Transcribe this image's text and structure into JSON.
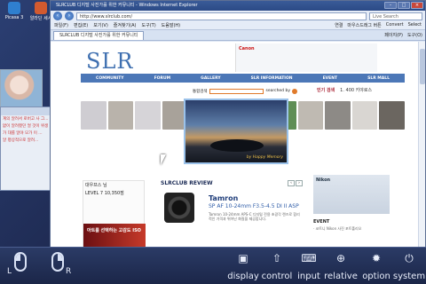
{
  "desktop": {
    "icons": [
      {
        "label": "Picasa 3",
        "color": "#2f7fcf"
      },
      {
        "label": "알라딘 세시",
        "color": "#d35a2f"
      }
    ],
    "left_window_lines": [
      "계의 알려서 로버고 사 그...",
      "없이 알려줬던 얼 것이 위생 ...",
      "가 대를 알야 모가 이 ...",
      "알 평상적으로 알려..."
    ]
  },
  "browser": {
    "title": "SLRCLUB 디지털 사진가를 위한 커뮤니티 - Windows Internet Explorer",
    "url": "http://www.slrclub.com/",
    "search_placeholder": "Live Search",
    "menu": [
      "파일(F)",
      "편집(E)",
      "보기(V)",
      "즐겨찾기(A)",
      "도구(T)",
      "도움말(H)"
    ],
    "menu_right": [
      "연결",
      "마우스드래그 버튼",
      "Convert",
      "Select"
    ],
    "tab_label": "SLRCLUB 디지털 사진가를 위한 커뮤니티",
    "tools": [
      "페이지(P)",
      "도구(O)"
    ]
  },
  "page": {
    "logo": "SLR",
    "banner_brand": "Canon",
    "nav": [
      "COMMUNITY",
      "FORUM",
      "GALLERY",
      "SLR INFORMATION",
      "EVENT",
      "SLR MALL"
    ],
    "search_label": "통합검색",
    "search_note": "searched by",
    "login_title": "인기 검색",
    "login_value": "1. 400 키야로스",
    "feature_caption": "by Happy Memory",
    "profile_title": "대우프스 님",
    "profile_level": "LEVEL 7",
    "profile_points": "10,350점",
    "ad_text": "아트를 선택하는 고감도 ISO",
    "review_heading": "SLRCLUB REVIEW",
    "review_brand": "Tamron",
    "review_model": "SP AF 10-24mm F3.5-4.5 DI II  ASP",
    "review_desc": "Tamron 10-24mm APS-C 디지털 전용 초광각 렌즈로 합리적인 가격과 뛰어난 화질을 제공합니다.",
    "nikon_label": "Nikon",
    "event_label": "EVENT",
    "event_line": "· 코트니 Nikon 사진 포트폴리오"
  },
  "toolbar": {
    "left_mouse_label": "L",
    "right_mouse_label": "R",
    "buttons": [
      {
        "label": "display",
        "icon": "display-icon"
      },
      {
        "label": "control",
        "icon": "control-icon"
      },
      {
        "label": "input",
        "icon": "keyboard-icon"
      },
      {
        "label": "relative",
        "icon": "relative-mouse-icon"
      },
      {
        "label": "option",
        "icon": "gear-icon"
      },
      {
        "label": "system",
        "icon": "power-icon"
      }
    ]
  }
}
